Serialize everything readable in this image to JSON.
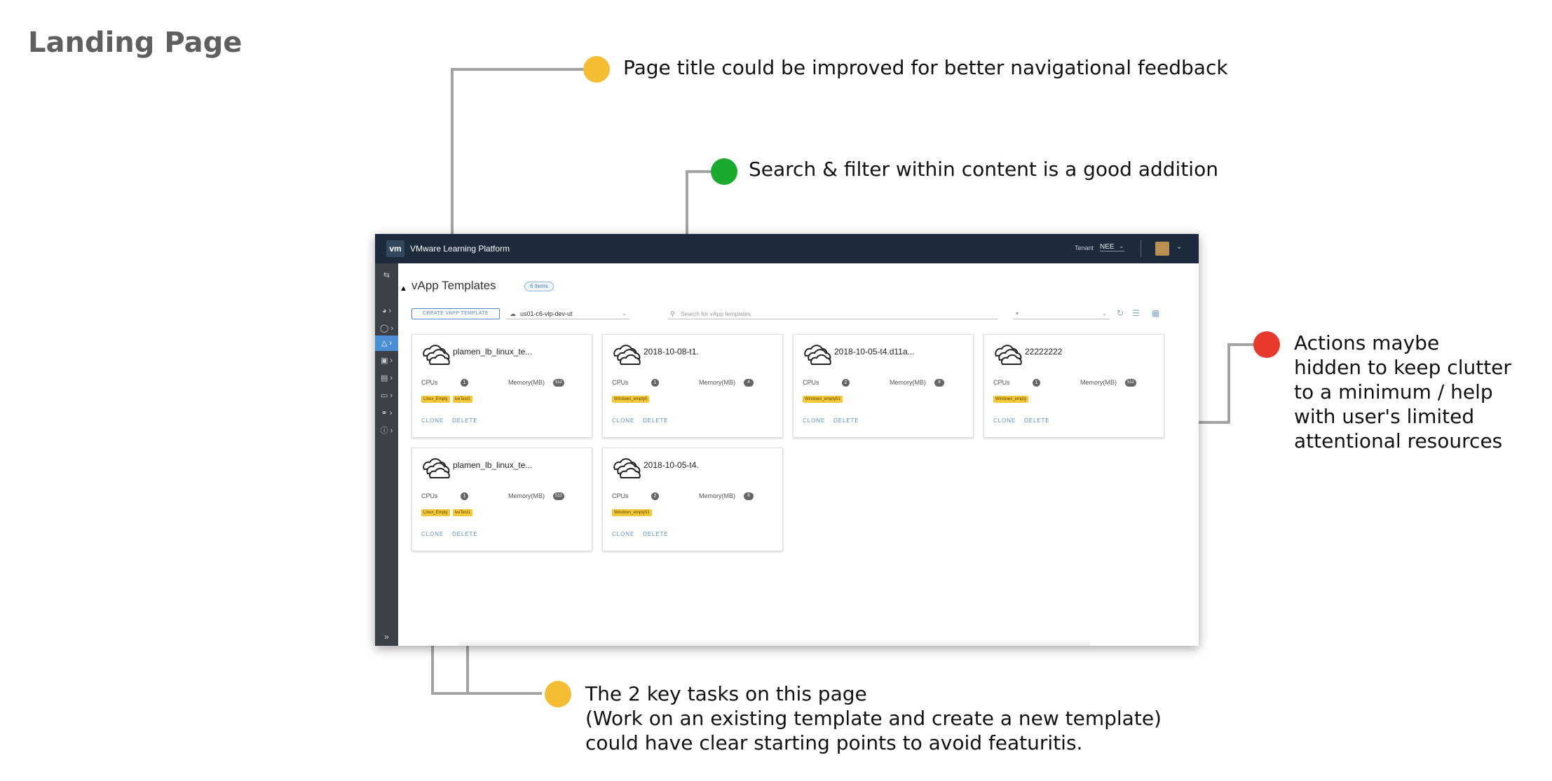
{
  "slide": {
    "title": "Landing Page"
  },
  "annotations": [
    {
      "text": "Page title could be improved for better navigational feedback",
      "color": "#f4bd34"
    },
    {
      "text": "Search & filter within content is a good addition",
      "color": "#1aab2e"
    },
    {
      "lines": [
        "Actions maybe",
        "hidden to keep clutter",
        "to a minimum / help",
        "with user's limited",
        "attentional resources"
      ],
      "color": "#e8392a"
    },
    {
      "lines": [
        "The 2 key tasks on this page",
        "(Work on an existing template and create a new template)",
        "could have clear starting points to avoid featuritis."
      ],
      "color": "#f4bd34"
    }
  ],
  "app": {
    "logo": "vm",
    "name": "VMware Learning Platform",
    "tenant_label": "Tenant",
    "tenant_value": "NEE",
    "page_title": "vApp Templates",
    "item_count": "6 items",
    "create_button": "CREATE VAPP TEMPLATE",
    "site": "us01-c6-vlp-dev-ut",
    "search_placeholder": "Search for vApp templates",
    "sidebar_icons": [
      "swap-icon",
      "dashboard-icon",
      "shield-icon",
      "lab-icon",
      "lock-icon",
      "building-icon",
      "folder-icon",
      "users-icon",
      "help-icon"
    ],
    "cards": [
      {
        "name": "plamen_lb_linux_te...",
        "cpus_label": "CPUs",
        "cpus": "1",
        "memory_label": "Memory(MB)",
        "memory": "512",
        "tags": [
          "Linux_Empty",
          "iveTest1"
        ],
        "clone": "CLONE",
        "delete": "DELETE"
      },
      {
        "name": "2018-10-08-t1.",
        "cpus_label": "CPUs",
        "cpus": "1",
        "memory_label": "Memory(MB)",
        "memory": "4",
        "tags": [
          "Windows_empty5"
        ],
        "clone": "CLONE",
        "delete": "DELETE"
      },
      {
        "name": "2018-10-05-t4.d11a...",
        "cpus_label": "CPUs",
        "cpus": "2",
        "memory_label": "Memory(MB)",
        "memory": "8",
        "tags": [
          "Windows_empty51"
        ],
        "clone": "CLONE",
        "delete": "DELETE"
      },
      {
        "name": "22222222",
        "cpus_label": "CPUs",
        "cpus": "1",
        "memory_label": "Memory(MB)",
        "memory": "512",
        "tags": [
          "Windows_empty"
        ],
        "clone": "CLONE",
        "delete": "DELETE"
      },
      {
        "name": "plamen_lb_linux_te...",
        "cpus_label": "CPUs",
        "cpus": "1",
        "memory_label": "Memory(MB)",
        "memory": "512",
        "tags": [
          "Linux_Empty",
          "iveTest1"
        ],
        "clone": "CLONE",
        "delete": "DELETE"
      },
      {
        "name": "2018-10-05-t4.",
        "cpus_label": "CPUs",
        "cpus": "2",
        "memory_label": "Memory(MB)",
        "memory": "8",
        "tags": [
          "Windows_empty51"
        ],
        "clone": "CLONE",
        "delete": "DELETE"
      }
    ]
  }
}
